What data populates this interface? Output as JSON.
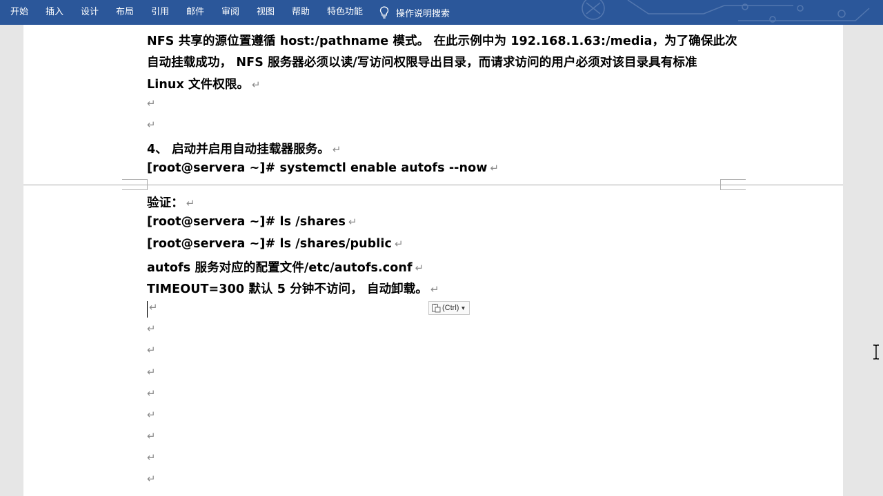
{
  "ribbon": {
    "tabs": [
      "开始",
      "插入",
      "设计",
      "布局",
      "引用",
      "邮件",
      "审阅",
      "视图",
      "帮助",
      "特色功能"
    ],
    "tell_me": "操作说明搜索"
  },
  "document": {
    "paragraph_mark": "↵",
    "lines": [
      "NFS 共享的源位置遵循 host:/pathname 模式。 在此示例中为 192.168.1.63:/media，为了确保此次",
      "自动挂载成功， NFS 服务器必须以读/写访问权限导出目录，而请求访问的用户必须对该目录具有标准",
      "Linux 文件权限。",
      "4、 启动并启用自动挂载器服务。",
      "[root@servera ~]# systemctl enable autofs --now",
      "验证：",
      "[root@servera ~]# ls /shares",
      "[root@servera ~]# ls /shares/public",
      "autofs 服务对应的配置文件/etc/autofs.conf",
      "TIMEOUT=300 默认 5 分钟不访问， 自动卸载。"
    ]
  },
  "paste_options": {
    "label": "(Ctrl)"
  }
}
